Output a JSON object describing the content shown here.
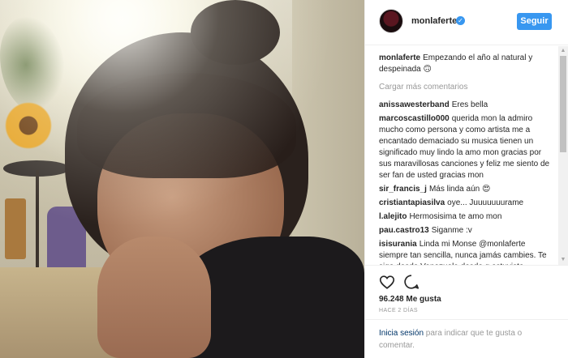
{
  "header": {
    "username": "monlaferte",
    "verified_glyph": "✓",
    "follow_label": "Seguir"
  },
  "caption": {
    "author": "monlaferte",
    "text": "Empezando el año al natural y despeinada 🙃"
  },
  "load_more_label": "Cargar más comentarios",
  "comments": [
    {
      "author": "anissawesterband",
      "text": "Eres bella"
    },
    {
      "author": "marcoscastillo000",
      "text": "querida mon la admiro mucho como persona y como artista me a encantado demaciado su musica tienen un significado muy lindo la amo mon gracias por sus maravillosas canciones y feliz me siento de ser fan de usted gracias mon"
    },
    {
      "author": "sir_francis_j",
      "text": "Más linda aún 😍"
    },
    {
      "author": "cristiantapiasilva",
      "text": "oye... Juuuuuuurame"
    },
    {
      "author": "l.alejito",
      "text": "Hermosisima te amo mon"
    },
    {
      "author": "pau.castro13",
      "text": "Siganme :v"
    },
    {
      "author": "isisurania",
      "text": "Linda mi Monse @monlaferte siempre tan sencilla, nunca jamás cambies. Te sigo desde Venezuela desde q estuviste"
    }
  ],
  "actions": {
    "like_icon": "heart-icon",
    "comment_icon": "comment-icon",
    "likes_text": "96.248 Me gusta",
    "time_text": "HACE 2 DÍAS"
  },
  "login": {
    "link_text": "Inicia sesión",
    "rest_text": " para indicar que te gusta o comentar."
  },
  "colors": {
    "accent": "#3897f0",
    "text": "#262626",
    "muted": "#999999",
    "link": "#003569"
  }
}
